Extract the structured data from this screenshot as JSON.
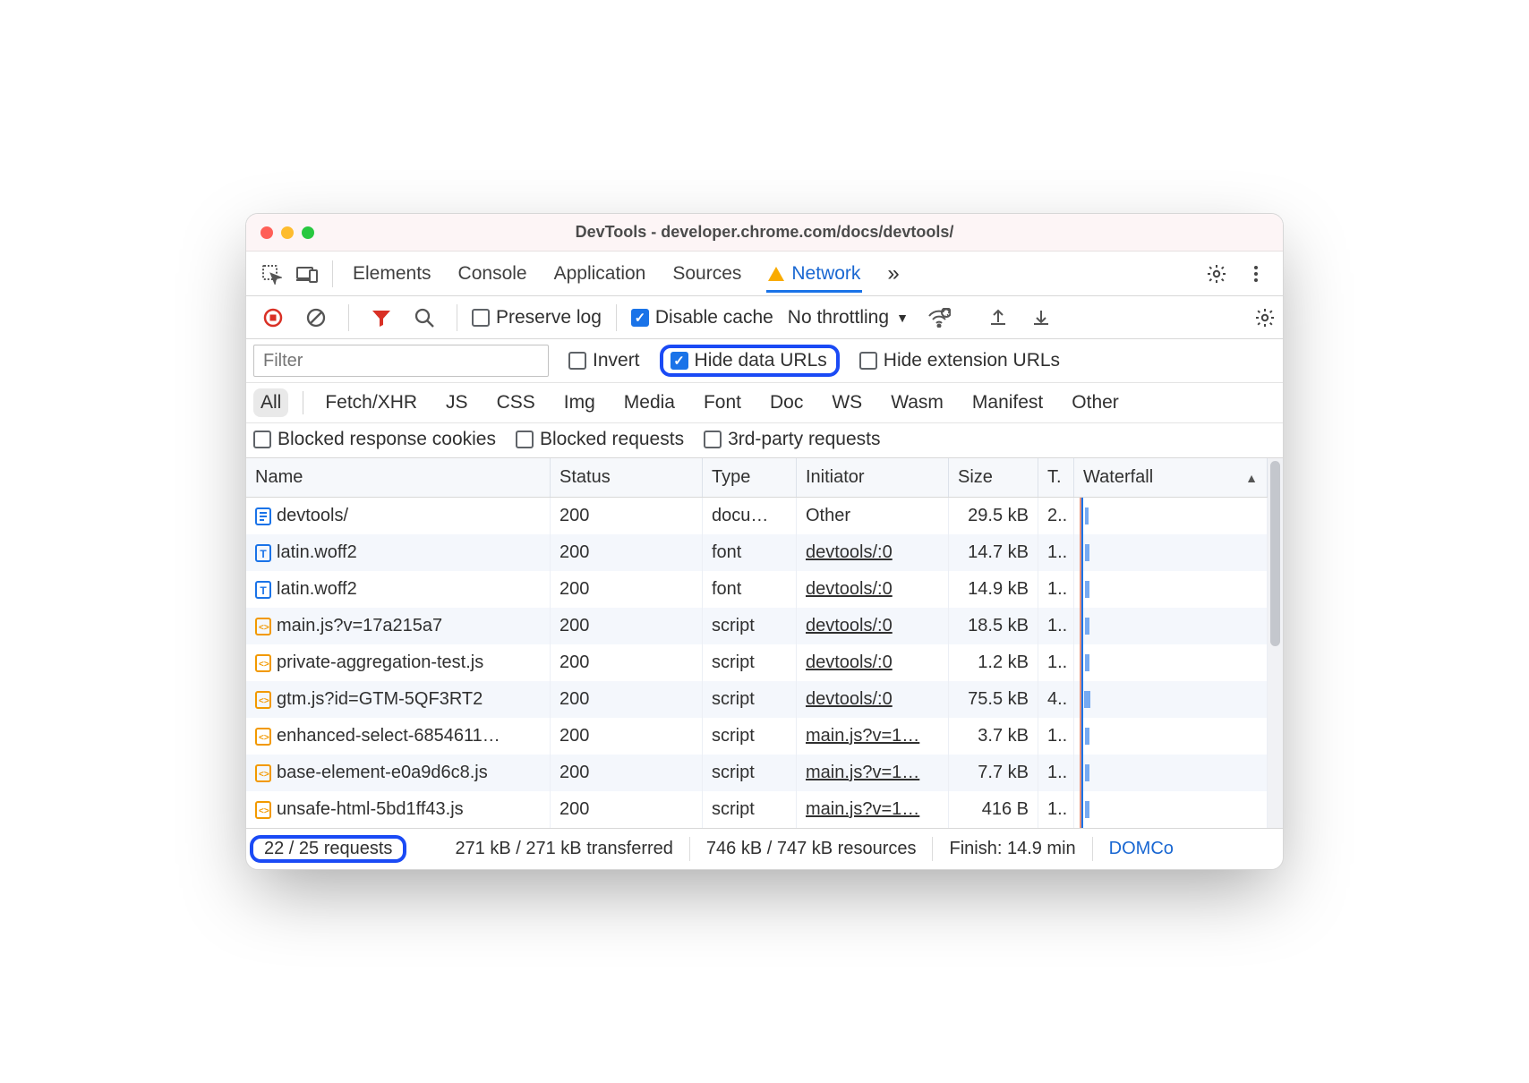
{
  "window": {
    "title": "DevTools - developer.chrome.com/docs/devtools/"
  },
  "tabs": {
    "items": [
      "Elements",
      "Console",
      "Application",
      "Sources",
      "Network"
    ],
    "active": "Network",
    "more": "»"
  },
  "toolbar": {
    "preserve_log": "Preserve log",
    "disable_cache": "Disable cache",
    "throttling": "No throttling"
  },
  "filter_row": {
    "filter_placeholder": "Filter",
    "invert": "Invert",
    "hide_data_urls": "Hide data URLs",
    "hide_ext_urls": "Hide extension URLs"
  },
  "type_chips": [
    "All",
    "Fetch/XHR",
    "JS",
    "CSS",
    "Img",
    "Media",
    "Font",
    "Doc",
    "WS",
    "Wasm",
    "Manifest",
    "Other"
  ],
  "blocked_row": {
    "blocked_cookies": "Blocked response cookies",
    "blocked_requests": "Blocked requests",
    "third_party": "3rd-party requests"
  },
  "columns": {
    "name": "Name",
    "status": "Status",
    "type": "Type",
    "initiator": "Initiator",
    "size": "Size",
    "time": "T.",
    "waterfall": "Waterfall"
  },
  "rows": [
    {
      "icon": "doc-blue",
      "name": "devtools/",
      "status": "200",
      "type": "docu…",
      "initiator": "Other",
      "initiator_link": false,
      "size": "29.5 kB",
      "time": "2..",
      "striped": false
    },
    {
      "icon": "font",
      "name": "latin.woff2",
      "status": "200",
      "type": "font",
      "initiator": "devtools/:0",
      "initiator_link": true,
      "size": "14.7 kB",
      "time": "1..",
      "striped": true
    },
    {
      "icon": "font",
      "name": "latin.woff2",
      "status": "200",
      "type": "font",
      "initiator": "devtools/:0",
      "initiator_link": true,
      "size": "14.9 kB",
      "time": "1..",
      "striped": false
    },
    {
      "icon": "js",
      "name": "main.js?v=17a215a7",
      "status": "200",
      "type": "script",
      "initiator": "devtools/:0",
      "initiator_link": true,
      "size": "18.5 kB",
      "time": "1..",
      "striped": true
    },
    {
      "icon": "js",
      "name": "private-aggregation-test.js",
      "status": "200",
      "type": "script",
      "initiator": "devtools/:0",
      "initiator_link": true,
      "size": "1.2 kB",
      "time": "1..",
      "striped": false
    },
    {
      "icon": "js",
      "name": "gtm.js?id=GTM-5QF3RT2",
      "status": "200",
      "type": "script",
      "initiator": "devtools/:0",
      "initiator_link": true,
      "size": "75.5 kB",
      "time": "4..",
      "striped": true
    },
    {
      "icon": "js",
      "name": "enhanced-select-6854611…",
      "status": "200",
      "type": "script",
      "initiator": "main.js?v=1…",
      "initiator_link": true,
      "size": "3.7 kB",
      "time": "1..",
      "striped": false
    },
    {
      "icon": "js",
      "name": "base-element-e0a9d6c8.js",
      "status": "200",
      "type": "script",
      "initiator": "main.js?v=1…",
      "initiator_link": true,
      "size": "7.7 kB",
      "time": "1..",
      "striped": true
    },
    {
      "icon": "js",
      "name": "unsafe-html-5bd1ff43.js",
      "status": "200",
      "type": "script",
      "initiator": "main.js?v=1…",
      "initiator_link": true,
      "size": "416 B",
      "time": "1..",
      "striped": false
    }
  ],
  "statusbar": {
    "requests": "22 / 25 requests",
    "transferred": "271 kB / 271 kB transferred",
    "resources": "746 kB / 747 kB resources",
    "finish": "Finish: 14.9 min",
    "domcontent": "DOMCo"
  }
}
